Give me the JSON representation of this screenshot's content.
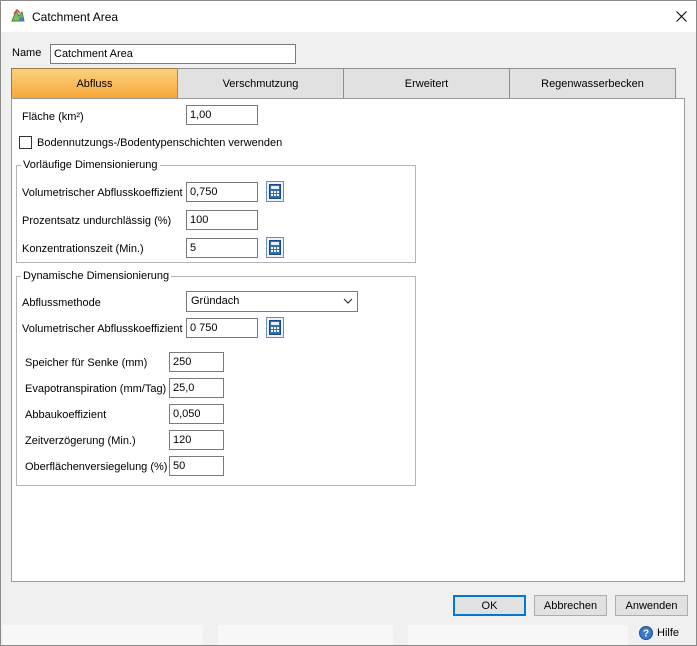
{
  "window": {
    "title": "Catchment Area",
    "close_label": "✕"
  },
  "name_field": {
    "label": "Name",
    "value": "Catchment Area"
  },
  "tabs": [
    {
      "label": "Abfluss",
      "active": true
    },
    {
      "label": "Verschmutzung",
      "active": false
    },
    {
      "label": "Erweitert",
      "active": false
    },
    {
      "label": "Regenwasserbecken",
      "active": false
    }
  ],
  "area": {
    "label": "Fläche (km²)",
    "value": "1,00"
  },
  "soil_layers_checkbox": {
    "label": "Bodennutzungs-/Bodentypenschichten verwenden",
    "checked": false
  },
  "preliminary": {
    "title": "Vorläufige Dimensionierung",
    "runoff_coeff": {
      "label": "Volumetrischer Abflusskoeffizient",
      "value": "0,750"
    },
    "impervious": {
      "label": "Prozentsatz undurchlässig (%)",
      "value": "100"
    },
    "concentration_time": {
      "label": "Konzentrationszeit (Min.)",
      "value": "5"
    }
  },
  "dynamic": {
    "title": "Dynamische Dimensionierung",
    "method": {
      "label": "Abflussmethode",
      "value": "Gründach"
    },
    "runoff_coeff": {
      "label": "Volumetrischer Abflusskoeffizient",
      "value": "0 750"
    },
    "storage": {
      "label": "Speicher für Senke (mm)",
      "value": "250"
    },
    "evapotranspiration": {
      "label": "Evapotranspiration (mm/Tag)",
      "value": "25,0"
    },
    "decay": {
      "label": "Abbaukoeffizient",
      "value": "0,050"
    },
    "delay": {
      "label": "Zeitverzögerung (Min.)",
      "value": "120"
    },
    "sealing": {
      "label": "Oberflächenversiegelung (%)",
      "value": "50"
    }
  },
  "buttons": {
    "ok": "OK",
    "cancel": "Abbrechen",
    "apply": "Anwenden"
  },
  "help": {
    "label": "Hilfe"
  },
  "colors": {
    "active_tab_top": "#fcd27e",
    "active_tab_bottom": "#f6a83a",
    "accent": "#0078d7"
  }
}
